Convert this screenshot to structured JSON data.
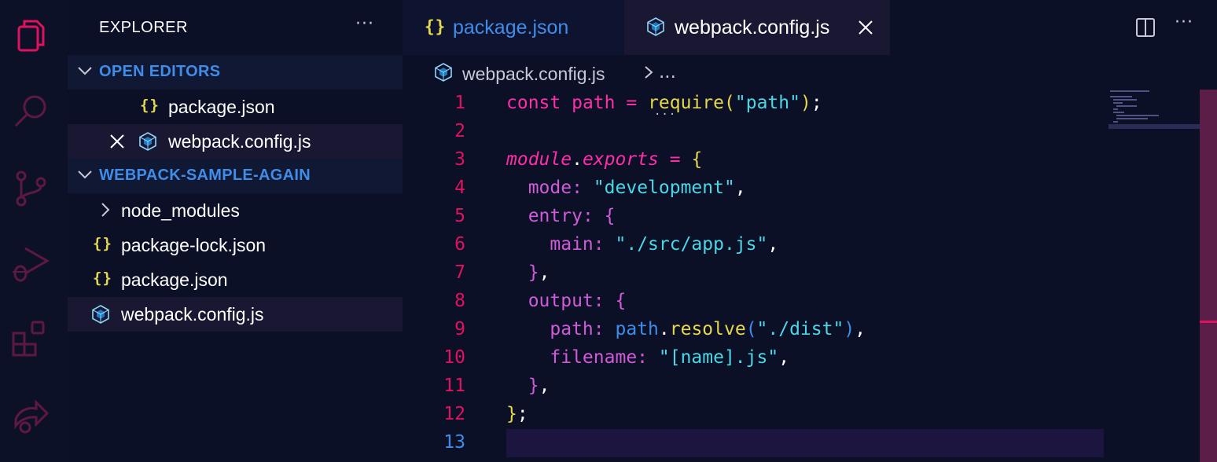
{
  "activity_bar": {
    "icons": [
      "files-icon",
      "search-icon",
      "source-control-icon",
      "run-debug-icon",
      "extensions-icon",
      "live-share-icon"
    ]
  },
  "sidebar": {
    "title": "EXPLORER",
    "more": "···",
    "open_editors": {
      "label": "OPEN EDITORS",
      "items": [
        {
          "name": "package.json",
          "icon": "json-icon"
        },
        {
          "name": "webpack.config.js",
          "icon": "webpack-icon",
          "active": true
        }
      ]
    },
    "workspace": {
      "label": "WEBPACK-SAMPLE-AGAIN",
      "items": [
        {
          "name": "node_modules",
          "type": "folder"
        },
        {
          "name": "package-lock.json",
          "icon": "json-icon"
        },
        {
          "name": "package.json",
          "icon": "json-icon"
        },
        {
          "name": "webpack.config.js",
          "icon": "webpack-icon",
          "selected": true
        }
      ]
    },
    "json_glyph": "{}"
  },
  "tabs": [
    {
      "label": "package.json",
      "icon": "json-icon"
    },
    {
      "label": "webpack.config.js",
      "icon": "webpack-icon",
      "active": true
    }
  ],
  "editor_actions": {
    "more": "···"
  },
  "breadcrumb": {
    "file": "webpack.config.js",
    "more": "..."
  },
  "editor": {
    "line_numbers": [
      "1",
      "2",
      "3",
      "4",
      "5",
      "6",
      "7",
      "8",
      "9",
      "10",
      "11",
      "12",
      "13"
    ],
    "active_line": "13",
    "inlay_hint": "···"
  },
  "colors": {
    "background": "#0b1027",
    "accent_blue": "#3f8ce9",
    "keyword_pink": "#ff2ea6",
    "string_cyan": "#4cd7e6",
    "function_yellow": "#e5d84c",
    "property_purple": "#d05bd6"
  }
}
